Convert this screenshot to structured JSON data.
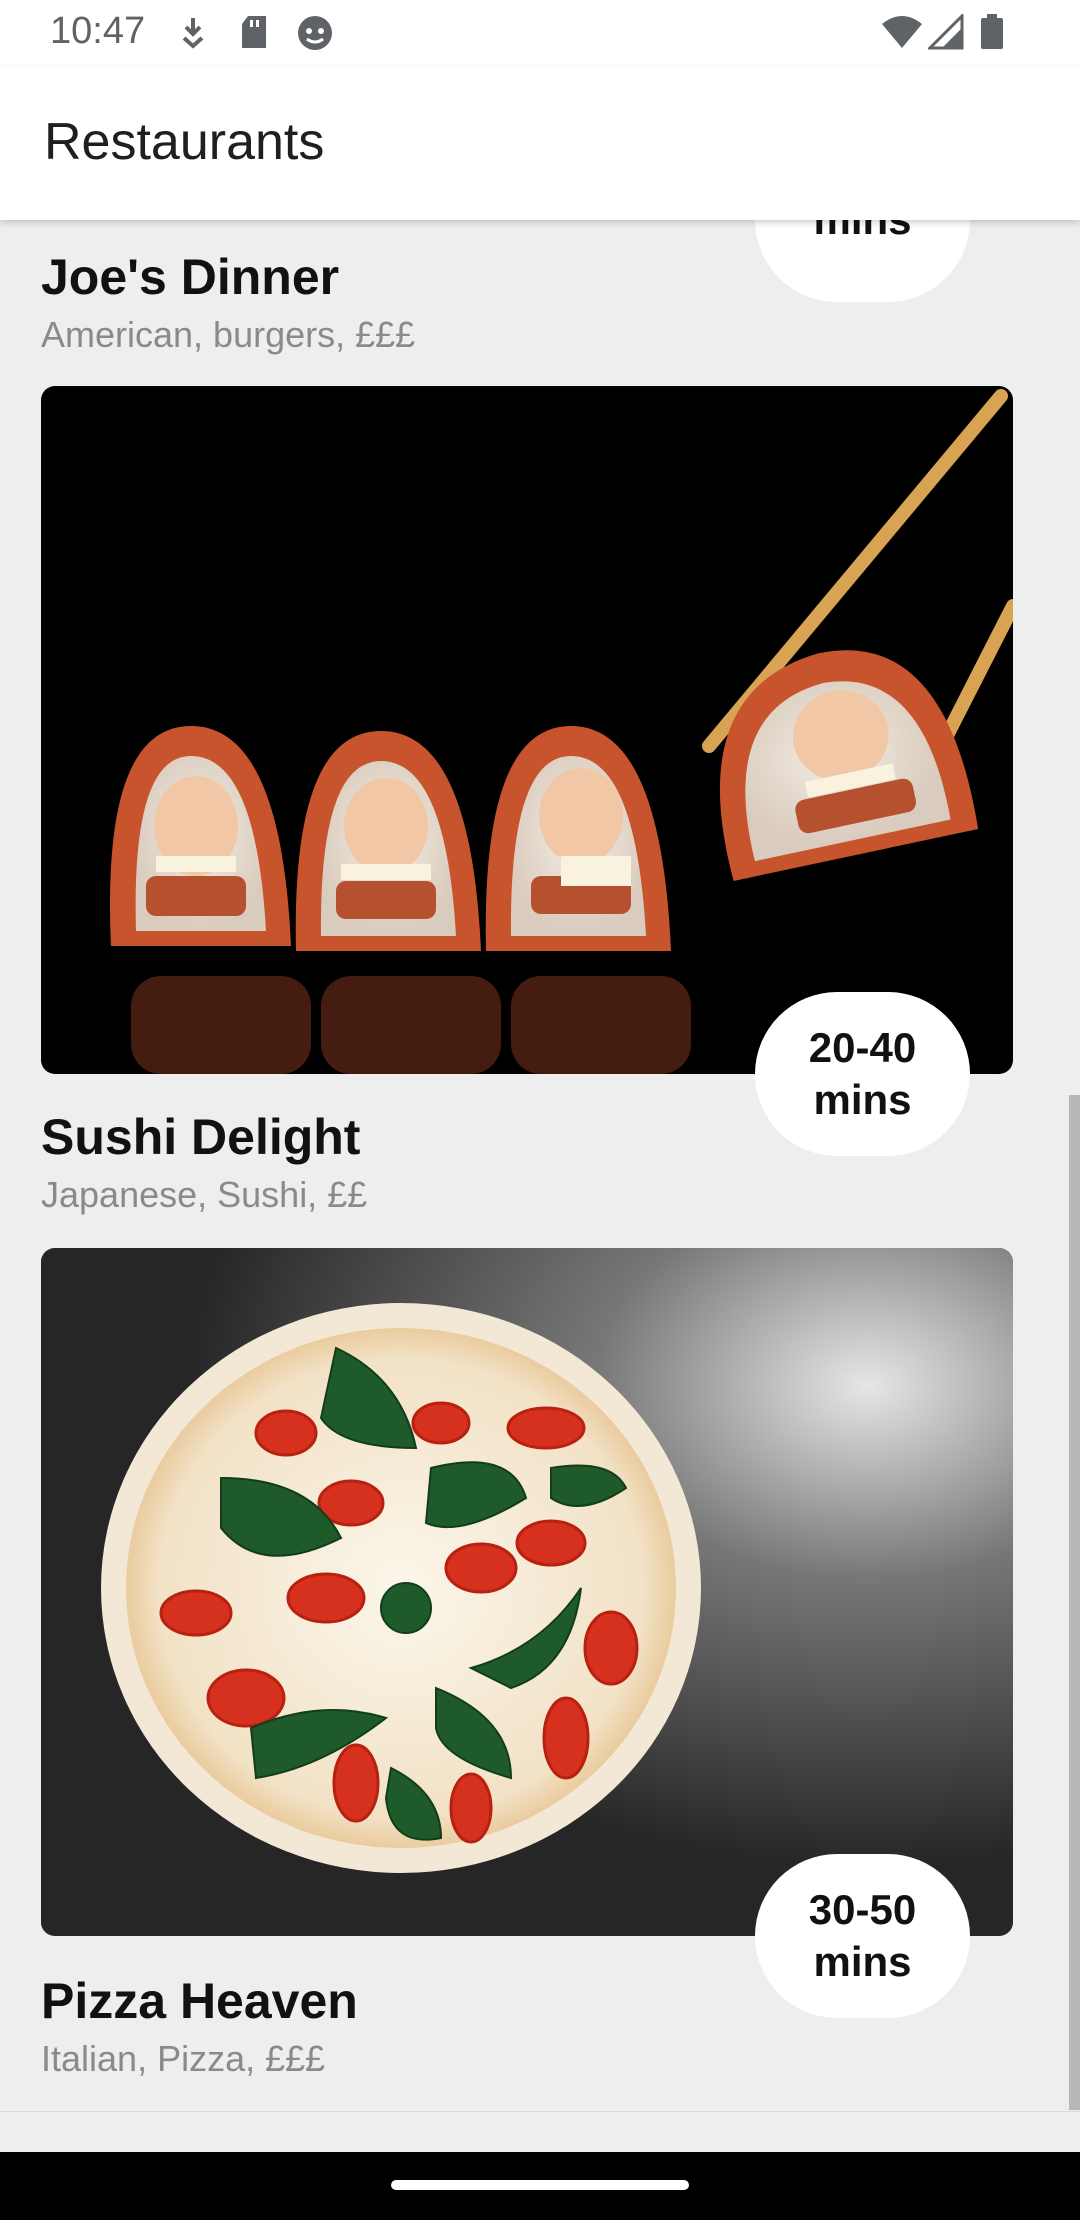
{
  "status_bar": {
    "time": "10:47",
    "icons_left": [
      "download-icon",
      "sd-card-icon",
      "android-debug-icon"
    ],
    "icons_right": [
      "wifi-icon",
      "signal-icon",
      "battery-icon"
    ]
  },
  "app_bar": {
    "title": "Restaurants"
  },
  "restaurants": [
    {
      "name": "Joe's Dinner",
      "subtitle": "American, burgers, £££",
      "time_line1": "",
      "time_line2": "mins"
    },
    {
      "name": "Sushi Delight",
      "subtitle": "Japanese, Sushi, ££",
      "time_line1": "20-40",
      "time_line2": "mins",
      "image": "sushi-image"
    },
    {
      "name": "Pizza Heaven",
      "subtitle": "Italian, Pizza, £££",
      "time_line1": "30-50",
      "time_line2": "mins",
      "image": "pizza-image"
    }
  ],
  "colors": {
    "background": "#efeeef",
    "bar": "#ffffff",
    "text": "#111111",
    "subtext": "#8a8a8a"
  }
}
